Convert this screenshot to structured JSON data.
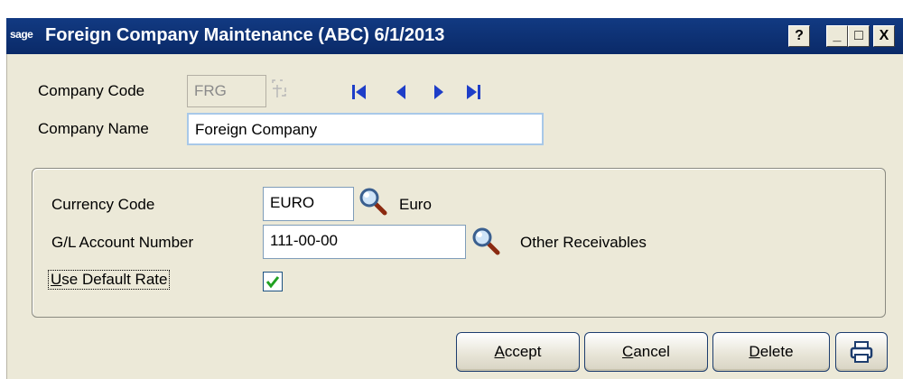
{
  "titlebar": {
    "logo_text": "sage",
    "title": "Foreign Company Maintenance (ABC) 6/1/2013",
    "help_label": "?",
    "minimize_label": "_",
    "maximize_label": "□",
    "close_label": "X"
  },
  "company": {
    "code_label": "Company Code",
    "code_value": "FRG",
    "name_label": "Company Name",
    "name_value": "Foreign Company"
  },
  "details": {
    "currency_label": "Currency Code",
    "currency_value": "EURO",
    "currency_desc": "Euro",
    "gl_label": "G/L Account Number",
    "gl_value": "111-00-00",
    "gl_desc": "Other Receivables",
    "default_rate_label": "Use Default Rate",
    "default_rate_checked": true
  },
  "buttons": {
    "accept": "Accept",
    "cancel": "Cancel",
    "delete": "Delete"
  },
  "icons": [
    "navigate-first-icon",
    "navigate-previous-icon",
    "navigate-next-icon",
    "navigate-last-icon",
    "lookup-magnifier-icon",
    "print-icon"
  ],
  "colors": {
    "titlebar": "#0a2a68",
    "window": "#ece9d8",
    "nav_arrows": "#1e3ec8"
  }
}
